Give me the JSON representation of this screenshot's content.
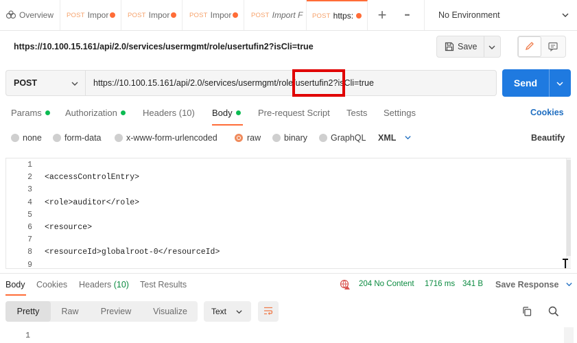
{
  "tabs": [
    {
      "method": "",
      "name": "Overview",
      "icon": "overview-icon",
      "dirty": false
    },
    {
      "method": "POST",
      "name": "Impor",
      "dirty": true
    },
    {
      "method": "POST",
      "name": "Impor",
      "dirty": true
    },
    {
      "method": "POST",
      "name": "Impor",
      "dirty": true
    },
    {
      "method": "POST",
      "name": "Import F",
      "dirty": false
    },
    {
      "method": "POST",
      "name": "https:",
      "dirty": true,
      "active": true
    }
  ],
  "tabbar": {
    "add_label": "+",
    "more_label": "•••"
  },
  "environment": {
    "label": "No Environment"
  },
  "request": {
    "title": "https://10.100.15.161/api/2.0/services/usermgmt/role/usertufin2?isCli=true",
    "method": "POST",
    "url": "https://10.100.15.161/api/2.0/services/usermgmt/role/usertufin2?isCli=true",
    "save_label": "Save",
    "send_label": "Send"
  },
  "request_tabs": {
    "params": "Params",
    "authorization": "Authorization",
    "headers": "Headers (10)",
    "body": "Body",
    "prerequest": "Pre-request Script",
    "tests": "Tests",
    "settings": "Settings",
    "cookies": "Cookies"
  },
  "body_types": {
    "none": "none",
    "form_data": "form-data",
    "urlencoded": "x-www-form-urlencoded",
    "raw": "raw",
    "binary": "binary",
    "graphql": "GraphQL",
    "format": "XML",
    "beautify": "Beautify",
    "selected": "raw"
  },
  "editor": {
    "lines": [
      {
        "n": "1",
        "code": ""
      },
      {
        "n": "2",
        "code": "<accessControlEntry>"
      },
      {
        "n": "3",
        "code": ""
      },
      {
        "n": "4",
        "code": "<role>auditor</role>"
      },
      {
        "n": "5",
        "code": ""
      },
      {
        "n": "6",
        "code": "<resource>"
      },
      {
        "n": "7",
        "code": ""
      },
      {
        "n": "8",
        "code": "<resourceId>globalroot-0</resourceId>"
      },
      {
        "n": "9",
        "code": ""
      }
    ]
  },
  "response": {
    "tabs": {
      "body": "Body",
      "cookies": "Cookies",
      "headers": "Headers",
      "headers_count": "(10)",
      "tests": "Test Results"
    },
    "status": "204 No Content",
    "time": "1716 ms",
    "size": "341 B",
    "save_label": "Save Response",
    "views": {
      "pretty": "Pretty",
      "raw": "Raw",
      "preview": "Preview",
      "visualize": "Visualize"
    },
    "text_format": "Text",
    "first_line": "1"
  },
  "colors": {
    "accent": "#ff6c37",
    "send": "#1f7ae0",
    "highlight": "#e00000",
    "status_ok": "#0a8a3f",
    "link": "#1f6ec1"
  }
}
